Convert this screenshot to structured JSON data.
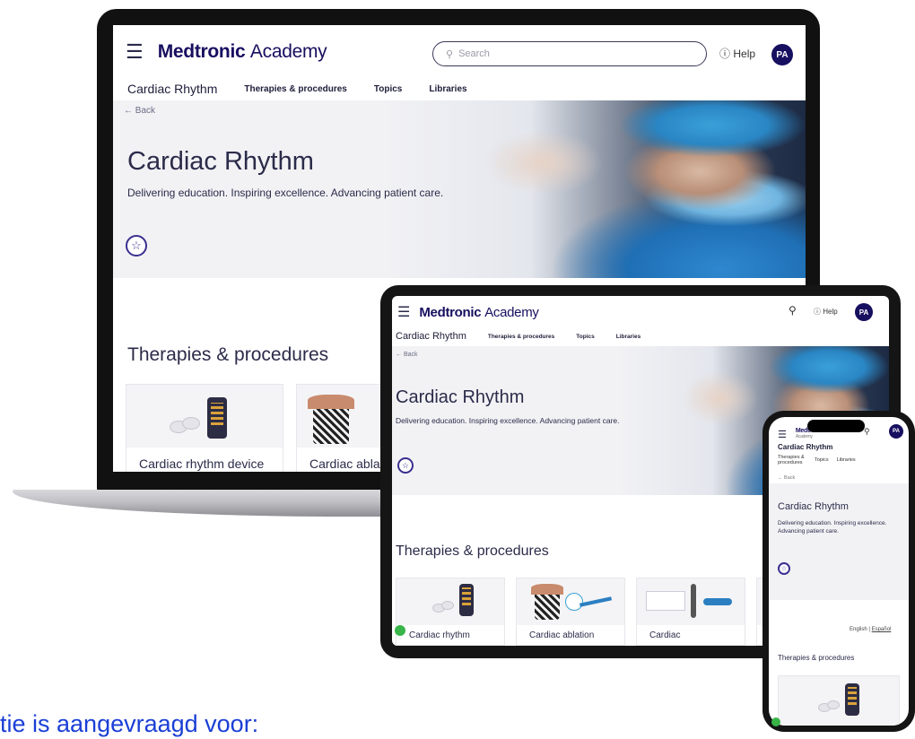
{
  "brand": {
    "name": "Medtronic",
    "product": "Academy"
  },
  "nav": {
    "search_placeholder": "Search",
    "help_label": "Help",
    "avatar_initials": "PA",
    "section": "Cardiac Rhythm",
    "links": [
      "Therapies & procedures",
      "Topics",
      "Libraries"
    ]
  },
  "hero": {
    "back_label": "Back",
    "title": "Cardiac Rhythm",
    "tagline": "Delivering education. Inspiring excellence. Advancing patient care."
  },
  "therapies": {
    "heading": "Therapies & procedures",
    "laptop_cards": [
      "Cardiac rhythm device",
      "Cardiac abla"
    ],
    "tablet_cards": [
      "Cardiac rhythm",
      "Cardiac ablation",
      "Cardiac"
    ]
  },
  "phone": {
    "brand_small": "Academy",
    "links": [
      "Therapies & procedures",
      "Topics",
      "Libraries"
    ],
    "lang_english": "English",
    "lang_separator": "|",
    "lang_spanish": "Español"
  },
  "icons": [
    "hamburger-menu-icon",
    "search-icon",
    "help-circle-icon",
    "star-icon",
    "back-arrow-icon"
  ],
  "colors": {
    "brand": "#170f5f",
    "caption": "#1a3fd6",
    "hero_bg": "#f2f2f5"
  },
  "caption": "tie is aangevraagd voor:"
}
